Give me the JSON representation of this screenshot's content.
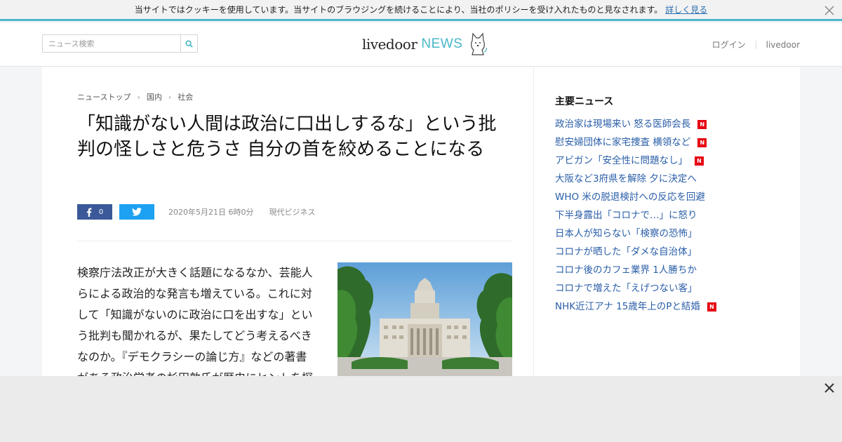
{
  "cookie_bar": {
    "message": "当サイトではクッキーを使用しています。当サイトのブラウジングを続けることにより、当社のポリシーを受け入れたものと見なされます。",
    "link_label": "詳しく見る"
  },
  "header": {
    "search_placeholder": "ニュース検索",
    "logo_main": "livedoor",
    "logo_sub": "NEWS",
    "nav": [
      "ログイン",
      "livedoor"
    ]
  },
  "article": {
    "breadcrumb": [
      "ニューストップ",
      "国内",
      "社会"
    ],
    "title": "「知識がない人間は政治に口出しするな」という批判の怪しさと危うさ 自分の首を絞めることになる",
    "facebook_count": "0",
    "date": "2020年5月21日 6時0分",
    "source": "現代ビジネス",
    "body": "検察庁法改正が大きく話題になるなか、芸能人らによる政治的な発言も増えている。これに対して「知識がないのに政治に口を出すな」という批判も聞かれるが、果たしてどう考えるべきなのか。『デモクラシーの論じ方』などの著書がある政治学者の杉田敦氏が歴史にヒントを探"
  },
  "sidebar": {
    "heading": "主要ニュース",
    "items": [
      {
        "label": "政治家は現場来い 怒る医師会長",
        "new": true
      },
      {
        "label": "慰安婦団体に家宅捜査 横領など",
        "new": true
      },
      {
        "label": "アビガン「安全性に問題なし」",
        "new": true
      },
      {
        "label": "大阪など3府県を解除 夕に決定へ",
        "new": false
      },
      {
        "label": "WHO 米の脱退検討への反応を回避",
        "new": false
      },
      {
        "label": "下半身露出「コロナで…」に怒り",
        "new": false
      },
      {
        "label": "日本人が知らない「検察の恐怖」",
        "new": false
      },
      {
        "label": "コロナが晒した「ダメな自治体」",
        "new": false
      },
      {
        "label": "コロナ後のカフェ業界 1人勝ちか",
        "new": false
      },
      {
        "label": "コロナで増えた「えげつない客」",
        "new": false
      },
      {
        "label": "NHK近江アナ 15歳年上のPと結婚",
        "new": true
      }
    ],
    "new_badge": "N"
  },
  "colors": {
    "accent": "#4ab7c8",
    "link": "#2a5ea8",
    "facebook": "#3b5998",
    "twitter": "#1da1f2",
    "new_badge": "#e60012"
  }
}
